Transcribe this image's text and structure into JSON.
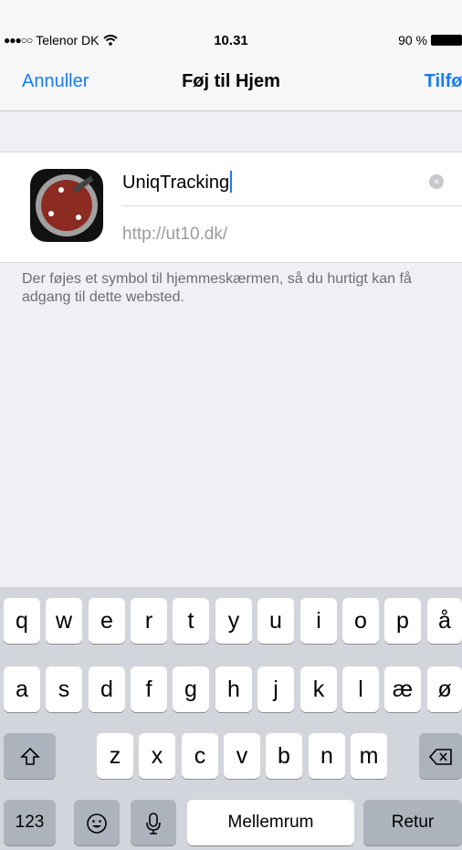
{
  "status_bar": {
    "signal": "●●●○○",
    "carrier": "Telenor DK",
    "wifi_icon": "wifi-icon",
    "time": "10.31",
    "battery": "90 %"
  },
  "nav": {
    "cancel": "Annuller",
    "title": "Føj til Hjem",
    "add": "Tilføj"
  },
  "form": {
    "name_value": "UniqTracking",
    "url": "http://ut10.dk/",
    "clear_icon": "clear-icon"
  },
  "hint": "Der føjes et symbol til hjemmeskærmen, så du hurtigt kan få adgang til dette websted.",
  "keyboard": {
    "row1": [
      "q",
      "w",
      "e",
      "r",
      "t",
      "y",
      "u",
      "i",
      "o",
      "p",
      "å"
    ],
    "row2": [
      "a",
      "s",
      "d",
      "f",
      "g",
      "h",
      "j",
      "k",
      "l",
      "æ",
      "ø"
    ],
    "row3": [
      "z",
      "x",
      "c",
      "v",
      "b",
      "n",
      "m"
    ],
    "shift_icon": "shift-icon",
    "delete_icon": "delete-icon",
    "numbers": "123",
    "emoji_icon": "emoji-icon",
    "mic_icon": "microphone-icon",
    "space": "Mellemrum",
    "return": "Retur"
  }
}
